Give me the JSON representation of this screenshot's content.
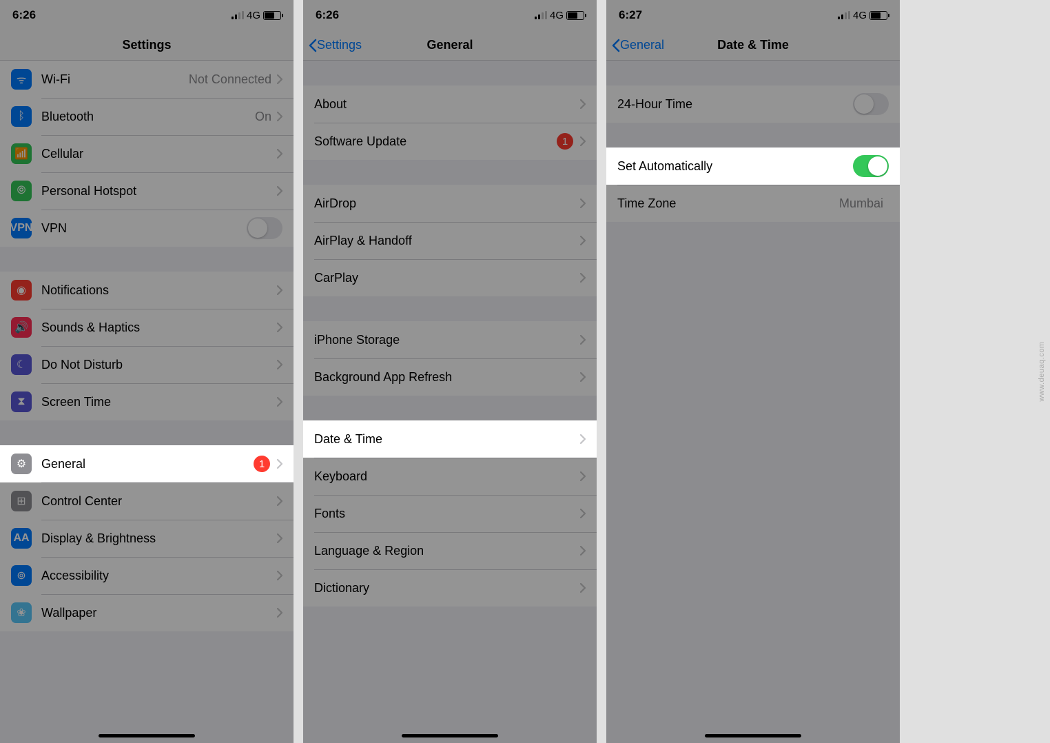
{
  "watermark": "www.deuaq.com",
  "screen1": {
    "time": "6:26",
    "network": "4G",
    "title": "Settings",
    "rows": {
      "wifi": {
        "label": "Wi-Fi",
        "value": "Not Connected"
      },
      "bluetooth": {
        "label": "Bluetooth",
        "value": "On"
      },
      "cellular": {
        "label": "Cellular"
      },
      "hotspot": {
        "label": "Personal Hotspot"
      },
      "vpn": {
        "label": "VPN"
      },
      "notifications": {
        "label": "Notifications"
      },
      "sounds": {
        "label": "Sounds & Haptics"
      },
      "dnd": {
        "label": "Do Not Disturb"
      },
      "screentime": {
        "label": "Screen Time"
      },
      "general": {
        "label": "General",
        "badge": "1"
      },
      "controlcenter": {
        "label": "Control Center"
      },
      "display": {
        "label": "Display & Brightness"
      },
      "accessibility": {
        "label": "Accessibility"
      },
      "wallpaper": {
        "label": "Wallpaper"
      }
    }
  },
  "screen2": {
    "time": "6:26",
    "network": "4G",
    "back": "Settings",
    "title": "General",
    "rows": {
      "about": {
        "label": "About"
      },
      "software": {
        "label": "Software Update",
        "badge": "1"
      },
      "airdrop": {
        "label": "AirDrop"
      },
      "airplay": {
        "label": "AirPlay & Handoff"
      },
      "carplay": {
        "label": "CarPlay"
      },
      "storage": {
        "label": "iPhone Storage"
      },
      "bgrefresh": {
        "label": "Background App Refresh"
      },
      "datetime": {
        "label": "Date & Time"
      },
      "keyboard": {
        "label": "Keyboard"
      },
      "fonts": {
        "label": "Fonts"
      },
      "language": {
        "label": "Language & Region"
      },
      "dictionary": {
        "label": "Dictionary"
      }
    }
  },
  "screen3": {
    "time": "6:27",
    "network": "4G",
    "back": "General",
    "title": "Date & Time",
    "rows": {
      "hour24": {
        "label": "24-Hour Time"
      },
      "auto": {
        "label": "Set Automatically"
      },
      "timezone": {
        "label": "Time Zone",
        "value": "Mumbai"
      }
    }
  }
}
